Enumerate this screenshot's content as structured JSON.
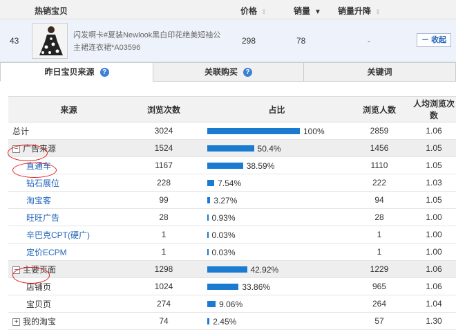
{
  "header": {
    "product_col": "热销宝贝",
    "price_col": "价格",
    "sales_col": "销量",
    "trend_col": "销量升降"
  },
  "product": {
    "index": "43",
    "name": "闪发啊卡#夏装Newlook黑白印花绝美短袖公主裙连衣裙*A03596",
    "price": "298",
    "sales": "78",
    "trend": "-",
    "collapse_label": "－ 收起"
  },
  "tabs": [
    {
      "label": "昨日宝贝来源",
      "active": true,
      "help": true
    },
    {
      "label": "关联购买",
      "active": false,
      "help": true
    },
    {
      "label": "关键词",
      "active": false,
      "help": false
    }
  ],
  "table": {
    "columns": [
      "来源",
      "浏览次数",
      "占比",
      "浏览人数",
      "人均浏览次数"
    ],
    "rows": [
      {
        "name": "总计",
        "type": "total",
        "views": "3024",
        "pct_value": 100,
        "pct": "100%",
        "visitors": "2859",
        "avg": "1.06"
      },
      {
        "name": "广告来源",
        "type": "group",
        "toggle": "−",
        "views": "1524",
        "pct_value": 50.4,
        "pct": "50.4%",
        "visitors": "1456",
        "avg": "1.05"
      },
      {
        "name": "直通车",
        "type": "link",
        "views": "1167",
        "pct_value": 38.59,
        "pct": "38.59%",
        "visitors": "1110",
        "avg": "1.05"
      },
      {
        "name": "钻石展位",
        "type": "link",
        "views": "228",
        "pct_value": 7.54,
        "pct": "7.54%",
        "visitors": "222",
        "avg": "1.03"
      },
      {
        "name": "淘宝客",
        "type": "link",
        "views": "99",
        "pct_value": 3.27,
        "pct": "3.27%",
        "visitors": "94",
        "avg": "1.05"
      },
      {
        "name": "旺旺广告",
        "type": "link",
        "views": "28",
        "pct_value": 0.93,
        "pct": "0.93%",
        "visitors": "28",
        "avg": "1.00"
      },
      {
        "name": "辛巴克CPT(硬广)",
        "type": "link",
        "views": "1",
        "pct_value": 0.03,
        "pct": "0.03%",
        "visitors": "1",
        "avg": "1.00"
      },
      {
        "name": "定价ECPM",
        "type": "link",
        "views": "1",
        "pct_value": 0.03,
        "pct": "0.03%",
        "visitors": "1",
        "avg": "1.00"
      },
      {
        "name": "主要页面",
        "type": "group",
        "toggle": "−",
        "views": "1298",
        "pct_value": 42.92,
        "pct": "42.92%",
        "visitors": "1229",
        "avg": "1.06"
      },
      {
        "name": "店铺页",
        "type": "plain",
        "views": "1024",
        "pct_value": 33.86,
        "pct": "33.86%",
        "visitors": "965",
        "avg": "1.06"
      },
      {
        "name": "宝贝页",
        "type": "plain",
        "views": "274",
        "pct_value": 9.06,
        "pct": "9.06%",
        "visitors": "264",
        "avg": "1.04"
      },
      {
        "name": "我的淘宝",
        "type": "collapsed",
        "toggle": "+",
        "views": "74",
        "pct_value": 2.45,
        "pct": "2.45%",
        "visitors": "57",
        "avg": "1.30"
      }
    ]
  },
  "colors": {
    "bar": "#1a7bd1",
    "link": "#2266bb",
    "annotation": "#e02020"
  }
}
